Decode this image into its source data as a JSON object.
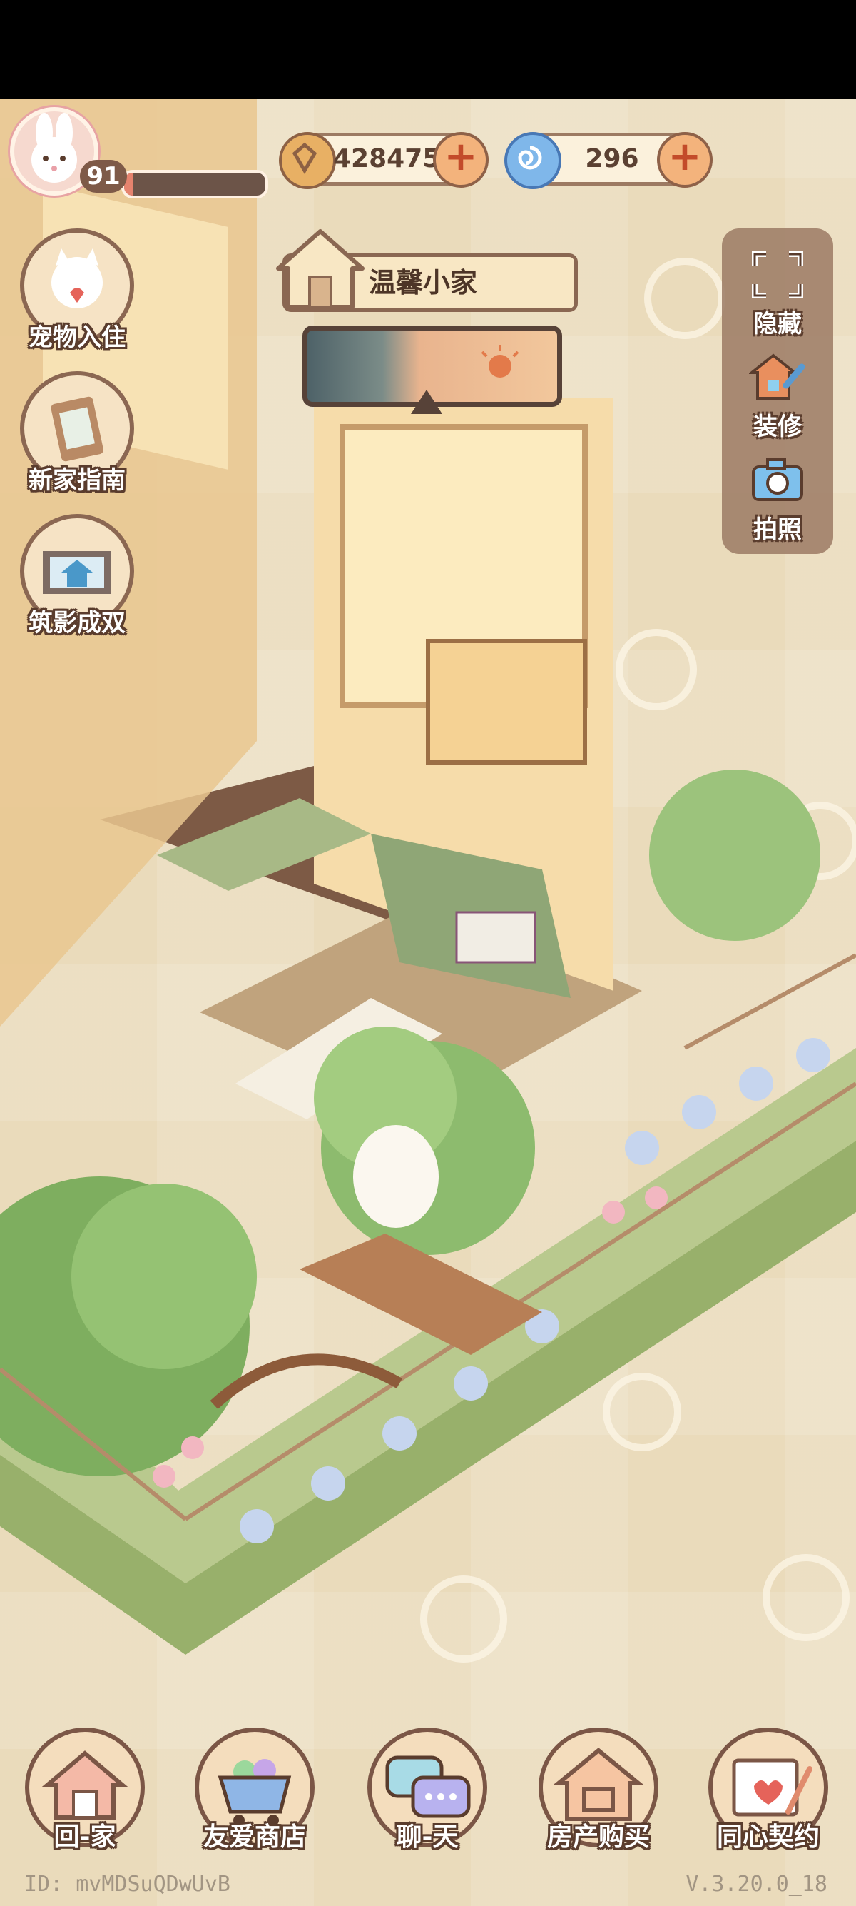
{
  "player": {
    "level": "91",
    "xp_fraction": 0.06
  },
  "currencies": [
    {
      "icon": "gold-coin-icon",
      "value": "428475",
      "plus": "+"
    },
    {
      "icon": "blue-swirl-gem-icon",
      "value": "296",
      "plus": "+"
    }
  ],
  "home": {
    "title": "温馨小家",
    "weather": "cloudy-to-sunny"
  },
  "left_menu": [
    {
      "label": "宠物入住",
      "icon": "cat-heart-icon"
    },
    {
      "label": "新家指南",
      "icon": "clipboard-guide-icon"
    },
    {
      "label": "筑影成双",
      "icon": "film-house-icon"
    }
  ],
  "right_menu": [
    {
      "label": "隐藏",
      "icon": "hide-frame-icon"
    },
    {
      "label": "装修",
      "icon": "house-wrench-icon"
    },
    {
      "label": "拍照",
      "icon": "camera-icon"
    }
  ],
  "bottom_nav": [
    {
      "label": "回-家",
      "icon": "house-icon"
    },
    {
      "label": "友爱商店",
      "icon": "shop-cart-icon"
    },
    {
      "label": "聊-天",
      "icon": "chat-bubbles-icon"
    },
    {
      "label": "房产购买",
      "icon": "property-icon"
    },
    {
      "label": "同心契约",
      "icon": "heart-letter-icon"
    }
  ],
  "footer": {
    "id": "ID:  mvMDSuQDwUvB",
    "version": "V.3.20.0_18"
  },
  "colors": {
    "accent": "#8b6752",
    "panel": "#9b7a64",
    "xp": "#e6836e",
    "plus": "#f3b37c"
  }
}
